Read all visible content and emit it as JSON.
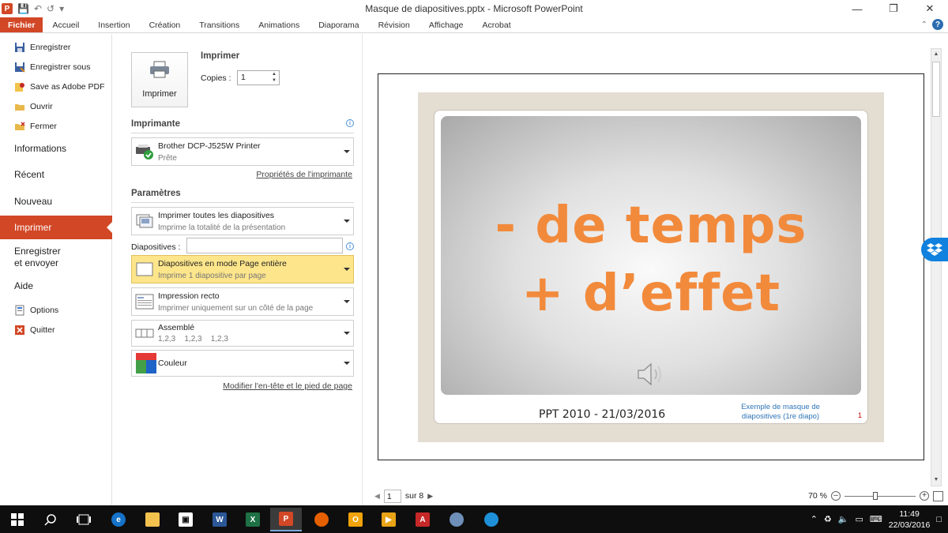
{
  "window": {
    "title": "Masque de diapositives.pptx - Microsoft PowerPoint",
    "app_logo": "P"
  },
  "ribbon": {
    "tabs": [
      "Fichier",
      "Accueil",
      "Insertion",
      "Création",
      "Transitions",
      "Animations",
      "Diaporama",
      "Révision",
      "Affichage",
      "Acrobat"
    ]
  },
  "backstage": {
    "commands": [
      {
        "label": "Enregistrer",
        "icon": "save-icon"
      },
      {
        "label": "Enregistrer sous",
        "icon": "save-as-icon"
      },
      {
        "label": "Save as Adobe PDF",
        "icon": "adobe-pdf-icon"
      },
      {
        "label": "Ouvrir",
        "icon": "open-folder-icon"
      },
      {
        "label": "Fermer",
        "icon": "close-folder-icon"
      }
    ],
    "tabs": [
      "Informations",
      "Récent",
      "Nouveau",
      "Imprimer",
      "Enregistrer\net envoyer",
      "Aide"
    ],
    "active_tab": "Imprimer",
    "bottom_commands": [
      {
        "label": "Options",
        "icon": "options-icon"
      },
      {
        "label": "Quitter",
        "icon": "exit-icon"
      }
    ]
  },
  "print": {
    "button_label": "Imprimer",
    "section_title": "Imprimer",
    "copies_label": "Copies :",
    "copies_value": "1",
    "printer_section": "Imprimante",
    "printer_name": "Brother DCP-J525W Printer",
    "printer_status": "Prête",
    "printer_properties_link": "Propriétés de l'imprimante",
    "settings_section": "Paramètres",
    "slides_label": "Diapositives :",
    "slides_value": "",
    "header_footer_link": "Modifier l'en-tête et le pied de page",
    "settings": [
      {
        "title": "Imprimer toutes les diapositives",
        "subtitle": "Imprime la totalité de la présentation"
      },
      {
        "title": "Diapositives en mode Page entière",
        "subtitle": "Imprime 1 diapositive par page"
      },
      {
        "title": "Impression recto",
        "subtitle": "Imprimer uniquement sur un côté de la page"
      },
      {
        "title": "Assemblé",
        "subtitle": "1,2,3    1,2,3    1,2,3"
      },
      {
        "title": "Couleur",
        "subtitle": ""
      }
    ]
  },
  "preview": {
    "slide_line1": "- de temps",
    "slide_line2": "+ d’effet",
    "footer_center": "PPT 2010 - 21/03/2016",
    "footer_right": "Exemple de masque de diapositives (1re diapo)",
    "slide_number": "1",
    "current_page": "1",
    "of_label": "sur 8",
    "zoom": "70 %"
  },
  "taskbar": {
    "time": "11:49",
    "date": "22/03/2016"
  },
  "colors": {
    "accent": "#d24726",
    "slide_text": "#f28a3c",
    "highlight": "#fde58b"
  }
}
